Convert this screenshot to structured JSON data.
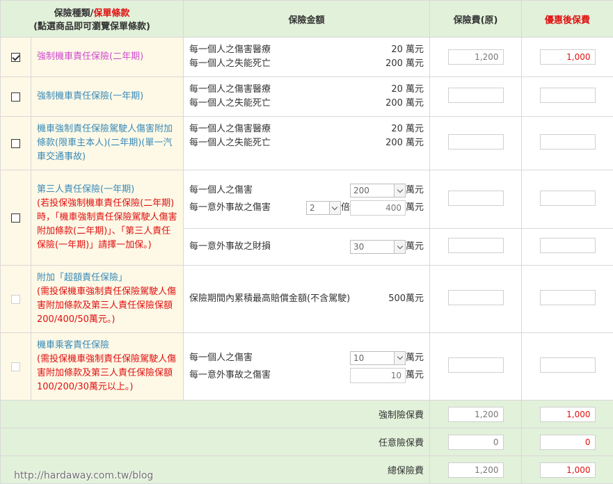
{
  "header": {
    "col1_line1_prefix": "保險種類/",
    "col1_line1_red": "保單條款",
    "col1_line2": "(點選商品即可瀏覽保單條款)",
    "col2": "保險金額",
    "col3": "保險費(原)",
    "col4": "優惠後保費"
  },
  "rows": {
    "r1": {
      "checked": true,
      "name": "強制機車責任保險(二年期)",
      "l1": "每一個人之傷害醫療",
      "v1": "20 萬元",
      "l2": "每一個人之失能死亡",
      "v2": "200 萬元",
      "orig": "1,200",
      "disc": "1,000"
    },
    "r2": {
      "name": "強制機車責任保險(一年期)",
      "l1": "每一個人之傷害醫療",
      "v1": "20 萬元",
      "l2": "每一個人之失能死亡",
      "v2": "200 萬元"
    },
    "r3": {
      "name": "機車強制責任保險駕駛人傷害附加條款(限車主本人)(二年期)(單一汽車交通事故)",
      "l1": "每一個人之傷害醫療",
      "v1": "20 萬元",
      "l2": "每一個人之失能死亡",
      "v2": "200 萬元"
    },
    "r4": {
      "name": "第三人責任保險(一年期)",
      "note": "(若投保強制機車責任保險(二年期)時，「機車強制責任保險駕駛人傷害附加條款(二年期)」、「第三人責任保險(一年期)」請擇一加保。)",
      "l1": "每一個人之傷害",
      "sel1": "200",
      "unit1": "萬元",
      "l2": "每一意外事故之傷害",
      "mult": "2",
      "mult_unit": "倍",
      "val2": "400",
      "unit2": "萬元",
      "l3": "每一意外事故之財損",
      "sel3": "30",
      "unit3": "萬元"
    },
    "r5": {
      "name": "附加「超額責任保險」",
      "note": "(需投保機車強制責任保險駕駛人傷害附加條款及第三人責任保險保額200/400/50萬元。)",
      "l1": "保險期間內累積最高賠償金額(不含駕駛)",
      "v1": "500萬元"
    },
    "r6": {
      "name": "機車乘客責任保險",
      "note": "(需投保機車強制責任保險駕駛人傷害附加條款及第三人責任保險保額100/200/30萬元以上。)",
      "l1": "每一個人之傷害",
      "sel1": "10",
      "unit1": "萬元",
      "l2": "每一意外事故之傷害",
      "val2": "10",
      "unit2": "萬元"
    }
  },
  "summary": {
    "compulsory_label": "強制險保費",
    "compulsory_orig": "1,200",
    "compulsory_disc": "1,000",
    "optional_label": "任意險保費",
    "optional_orig": "0",
    "optional_disc": "0",
    "total_label": "總保險費",
    "total_orig": "1,200",
    "total_disc": "1,000"
  },
  "watermark": "http://hardaway.com.tw/blog"
}
